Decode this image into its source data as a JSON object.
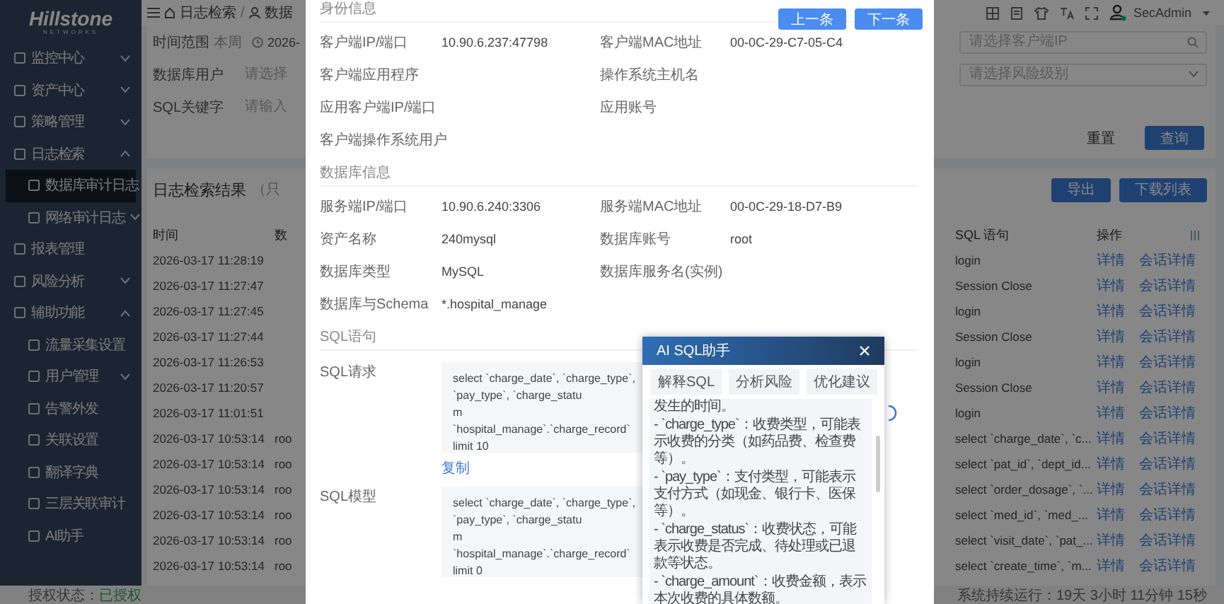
{
  "sidebar": {
    "logo": "Hillstone",
    "logo_tagline": "NETWORKS",
    "items": [
      {
        "label": "监控中心",
        "expanded": false,
        "selected": false
      },
      {
        "label": "资产中心",
        "expanded": false,
        "selected": false
      },
      {
        "label": "策略管理",
        "expanded": false,
        "selected": false
      },
      {
        "label": "日志检索",
        "expanded": true,
        "selected": false,
        "children": [
          {
            "label": "数据库审计日志",
            "selected": true
          },
          {
            "label": "网络审计日志",
            "expanded": false,
            "selected": false
          }
        ]
      },
      {
        "label": "报表管理",
        "selected": false
      },
      {
        "label": "风险分析",
        "expanded": false,
        "selected": false
      },
      {
        "label": "辅助功能",
        "expanded": true,
        "selected": false,
        "children": [
          {
            "label": "流量采集设置",
            "selected": false
          },
          {
            "label": "用户管理",
            "expanded": false,
            "selected": false
          },
          {
            "label": "告警外发",
            "selected": false
          },
          {
            "label": "关联设置",
            "selected": false
          },
          {
            "label": "翻译字典",
            "selected": false
          },
          {
            "label": "三层关联审计",
            "selected": false
          },
          {
            "label": "AI助手",
            "selected": false
          }
        ]
      }
    ]
  },
  "header": {
    "breadcrumb": [
      "日志检索",
      "数据"
    ],
    "breadcrumb_separator": "/",
    "user": "SecAdmin"
  },
  "filters": {
    "time_range_label": "时间范围",
    "time_range_tag": "本周",
    "date_value": "2026-",
    "db_user_label": "数据库用户",
    "db_user_placeholder": "请选择",
    "sql_keyword_label": "SQL关键字",
    "sql_keyword_placeholder": "请输入",
    "client_ip_placeholder": "请选择客户端IP",
    "risk_level_placeholder": "请选择风险级别",
    "buttons": [
      "重置",
      "查询"
    ]
  },
  "results": {
    "title": "日志检索结果",
    "note": "（只",
    "buttons": [
      "导出",
      "下载列表"
    ],
    "columns": [
      "时间",
      "数",
      "SQL 语句",
      "操作"
    ],
    "rows": [
      {
        "time": "2026-03-17 11:28:19",
        "sql": "login",
        "actions": [
          "详情",
          "会话详情"
        ]
      },
      {
        "time": "2026-03-17 11:27:47",
        "sql": "Session Close",
        "actions": [
          "详情",
          "会话详情"
        ]
      },
      {
        "time": "2026-03-17 11:27:45",
        "sql": "login",
        "actions": [
          "详情",
          "会话详情"
        ]
      },
      {
        "time": "2026-03-17 11:27:44",
        "sql": "Session Close",
        "actions": [
          "详情",
          "会话详情"
        ]
      },
      {
        "time": "2026-03-17 11:26:53",
        "sql": "login",
        "actions": [
          "详情",
          "会话详情"
        ]
      },
      {
        "time": "2026-03-17 11:20:57",
        "sql": "Session Close",
        "actions": [
          "详情",
          "会话详情"
        ]
      },
      {
        "time": "2026-03-17 11:01:51",
        "sql": "login",
        "actions": [
          "详情",
          "会话详情"
        ]
      },
      {
        "time": "2026-03-17 10:53:14",
        "column_2": "roo",
        "sql": "select `charge_date`, `c...",
        "actions": [
          "详情",
          "会话详情"
        ]
      },
      {
        "time": "2026-03-17 10:53:14",
        "column_2": "roo",
        "sql": "select `pat_id`, `dept_id...",
        "actions": [
          "详情",
          "会话详情"
        ]
      },
      {
        "time": "2026-03-17 10:53:14",
        "column_2": "roo",
        "sql": "select `order_dosage`, `...",
        "actions": [
          "详情",
          "会话详情"
        ]
      },
      {
        "time": "2026-03-17 10:53:14",
        "column_2": "roo",
        "sql": "select `med_id`, `med_...",
        "actions": [
          "详情",
          "会话详情"
        ]
      },
      {
        "time": "2026-03-17 10:53:14",
        "column_2": "roo",
        "sql": "select `visit_date`, `pat_...",
        "actions": [
          "详情",
          "会话详情"
        ]
      },
      {
        "time": "2026-03-17 10:53:14",
        "column_2": "roo",
        "sql": "select `create_time`, `m...",
        "actions": [
          "详情",
          "会话详情"
        ]
      }
    ]
  },
  "detail_dialog": {
    "buttons": [
      "上一条",
      "下一条"
    ],
    "sections": [
      {
        "title": "身份信息",
        "fields": [
          {
            "label": "客户端IP/端口",
            "value": "10.90.6.237:47798"
          },
          {
            "label": "客户端MAC地址",
            "value": "00-0C-29-C7-05-C4"
          },
          {
            "label": "客户端应用程序"
          },
          {
            "label": "操作系统主机名"
          },
          {
            "label": "应用客户端IP/端口"
          },
          {
            "label": "应用账号"
          },
          {
            "label": "客户端操作系统用户"
          }
        ]
      },
      {
        "title": "数据库信息",
        "fields": [
          {
            "label": "服务端IP/端口",
            "value": "10.90.6.240:3306"
          },
          {
            "label": "服务端MAC地址",
            "value": "00-0C-29-18-D7-B9"
          },
          {
            "label": "资产名称",
            "value": "240mysql"
          },
          {
            "label": "数据库账号",
            "value": "root"
          },
          {
            "label": "数据库类型",
            "value": "MySQL"
          },
          {
            "label": "数据库服务名(实例)"
          },
          {
            "label": "数据库与Schema",
            "value": "*.hospital_manage"
          }
        ]
      }
    ],
    "sql_section": {
      "title": "SQL语句",
      "request_label": "SQL请求",
      "request_lines": [
        "select `charge_date`, `charge_type`, `pay_type`, `charge_statu",
        "m `hospital_manage`.`charge_record` limit 10"
      ],
      "copy_link": "复制",
      "model_label": "SQL模型",
      "model_lines": [
        "select `charge_date`, `charge_type`, `pay_type`, `charge_statu",
        "m `hospital_manage`.`charge_record` limit 0"
      ]
    }
  },
  "ai_assistant": {
    "title": "AI SQL助手",
    "tabs": [
      {
        "label": "解释SQL",
        "selected": false
      },
      {
        "label": "分析风险",
        "selected": false
      },
      {
        "label": "优化建议",
        "selected": false
      }
    ],
    "paragraphs": [
      "发生的时间。",
      "- `charge_type`：收费类型，可能表示收费的分类（如药品费、检查费等）。",
      "- `pay_type`：支付类型，可能表示支付方式（如现金、银行卡、医保等）。",
      "- `charge_status`：收费状态，可能表示收费是否完成、待处理或已退款等状态。",
      "- `charge_amount`：收费金额，表示本次收费的具体数额。"
    ]
  },
  "status_bar": {
    "license_label": "授权状态：",
    "license_value": "已授权",
    "uptime": "系统持续运行：19天 3小时 11分钟 15秒"
  }
}
